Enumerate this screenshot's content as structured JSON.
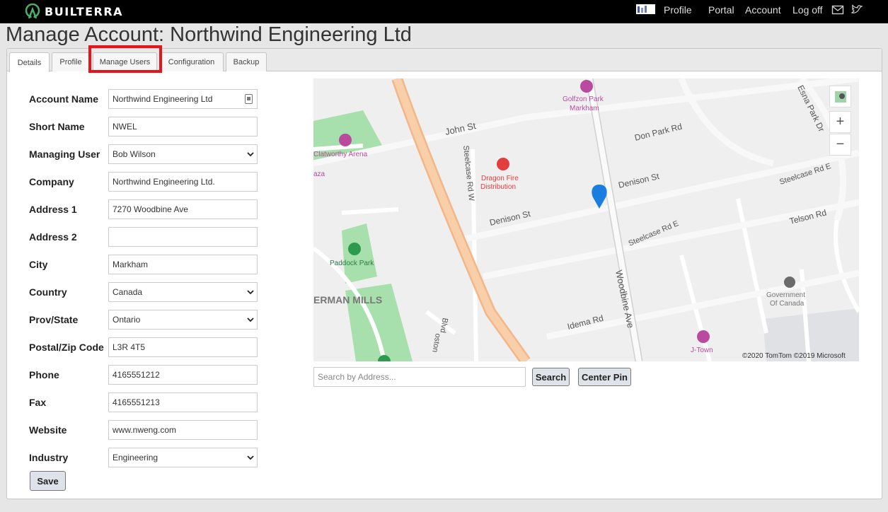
{
  "header": {
    "brand": "BUILTERRA",
    "nav": [
      "Profile",
      "Portal",
      "Account",
      "Log off"
    ],
    "icons": [
      "mail-icon",
      "twitter-icon"
    ]
  },
  "page_title": "Manage Account: Northwind Engineering Ltd",
  "tabs": [
    "Details",
    "Profile",
    "Manage Users",
    "Configuration",
    "Backup"
  ],
  "active_tab": "Details",
  "highlighted_tab": "Manage Users",
  "form": {
    "account_name": {
      "label": "Account Name",
      "value": "Northwind Engineering Ltd"
    },
    "short_name": {
      "label": "Short Name",
      "value": "NWEL"
    },
    "managing_user": {
      "label": "Managing User",
      "value": "Bob Wilson"
    },
    "company": {
      "label": "Company",
      "value": "Northwind Engineering Ltd."
    },
    "address1": {
      "label": "Address 1",
      "value": "7270 Woodbine Ave"
    },
    "address2": {
      "label": "Address 2",
      "value": ""
    },
    "city": {
      "label": "City",
      "value": "Markham"
    },
    "country": {
      "label": "Country",
      "value": "Canada"
    },
    "prov_state": {
      "label": "Prov/State",
      "value": "Ontario"
    },
    "postal": {
      "label": "Postal/Zip Code",
      "value": "L3R 4T5"
    },
    "phone": {
      "label": "Phone",
      "value": "4165551212"
    },
    "fax": {
      "label": "Fax",
      "value": "4165551213"
    },
    "website": {
      "label": "Website",
      "value": "www.nweng.com"
    },
    "industry": {
      "label": "Industry",
      "value": "Engineering"
    },
    "save_label": "Save"
  },
  "map": {
    "labels": {
      "john_st": "John St",
      "golfzon": "Golfzon Park",
      "golfzon2": "Markham",
      "don_park": "Don Park Rd",
      "esna": "Esna Park Dr",
      "clatworthy": "Clatworthy Arena",
      "aza": "aza",
      "dragon1": "Dragon Fire",
      "dragon2": "Distribution",
      "steelcase_w": "Steelcase Rd W",
      "denison_st1": "Denison St",
      "denison_st2": "Denison St",
      "steelcase_e1": "Steelcase Rd E",
      "steelcase_e2": "Steelcase Rd E",
      "telson": "Telson Rd",
      "paddock": "Paddock Park",
      "erman": "ERMAN MILLS",
      "woodbine": "Woodbine Ave",
      "gov1": "Government",
      "gov2": "Of Canada",
      "idema": "Idema Rd",
      "jtown": "J-Town",
      "blvd": "Blvd",
      "oston": "oston"
    },
    "copyright": "©2020 TomTom ©2019 Microsoft",
    "controls": [
      "layers-icon",
      "+",
      "−"
    ]
  },
  "search": {
    "placeholder": "Search by Address...",
    "search_label": "Search",
    "center_label": "Center Pin"
  }
}
